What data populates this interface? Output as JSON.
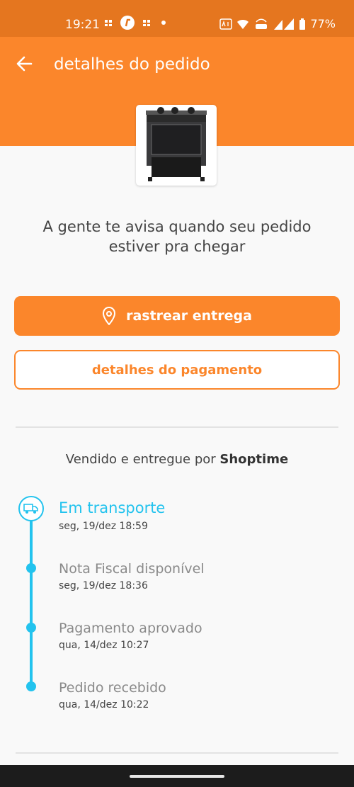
{
  "status_bar": {
    "time": "19:21",
    "battery": "77%",
    "icons": [
      "notification-icon",
      "app-icon",
      "notification-icon",
      "dot-icon",
      "auto-icon",
      "wifi-icon",
      "volte-icon",
      "signal-icon",
      "battery-icon"
    ]
  },
  "header": {
    "title": "detalhes do pedido",
    "back_icon": "arrow-left-icon"
  },
  "product": {
    "image": "stove-product-image"
  },
  "notice": {
    "line1": "A gente te avisa quando seu pedido",
    "line2": "estiver pra chegar"
  },
  "actions": {
    "track_label": "rastrear entrega",
    "track_icon": "location-pin-icon",
    "payment_label": "detalhes do pagamento"
  },
  "seller": {
    "prefix": "Vendido e entregue por",
    "name": "Shoptime"
  },
  "timeline": [
    {
      "title": "Em transporte",
      "date": "seg, 19/dez 18:59",
      "active": true
    },
    {
      "title": "Nota Fiscal disponível",
      "date": "seg, 19/dez 18:36",
      "active": false
    },
    {
      "title": "Pagamento aprovado",
      "date": "qua, 14/dez 10:27",
      "active": false
    },
    {
      "title": "Pedido recebido",
      "date": "qua, 14/dez 10:22",
      "active": false
    }
  ],
  "colors": {
    "brand": "#fb862b",
    "status_bar": "#e5761f",
    "timeline": "#23c3ee"
  }
}
